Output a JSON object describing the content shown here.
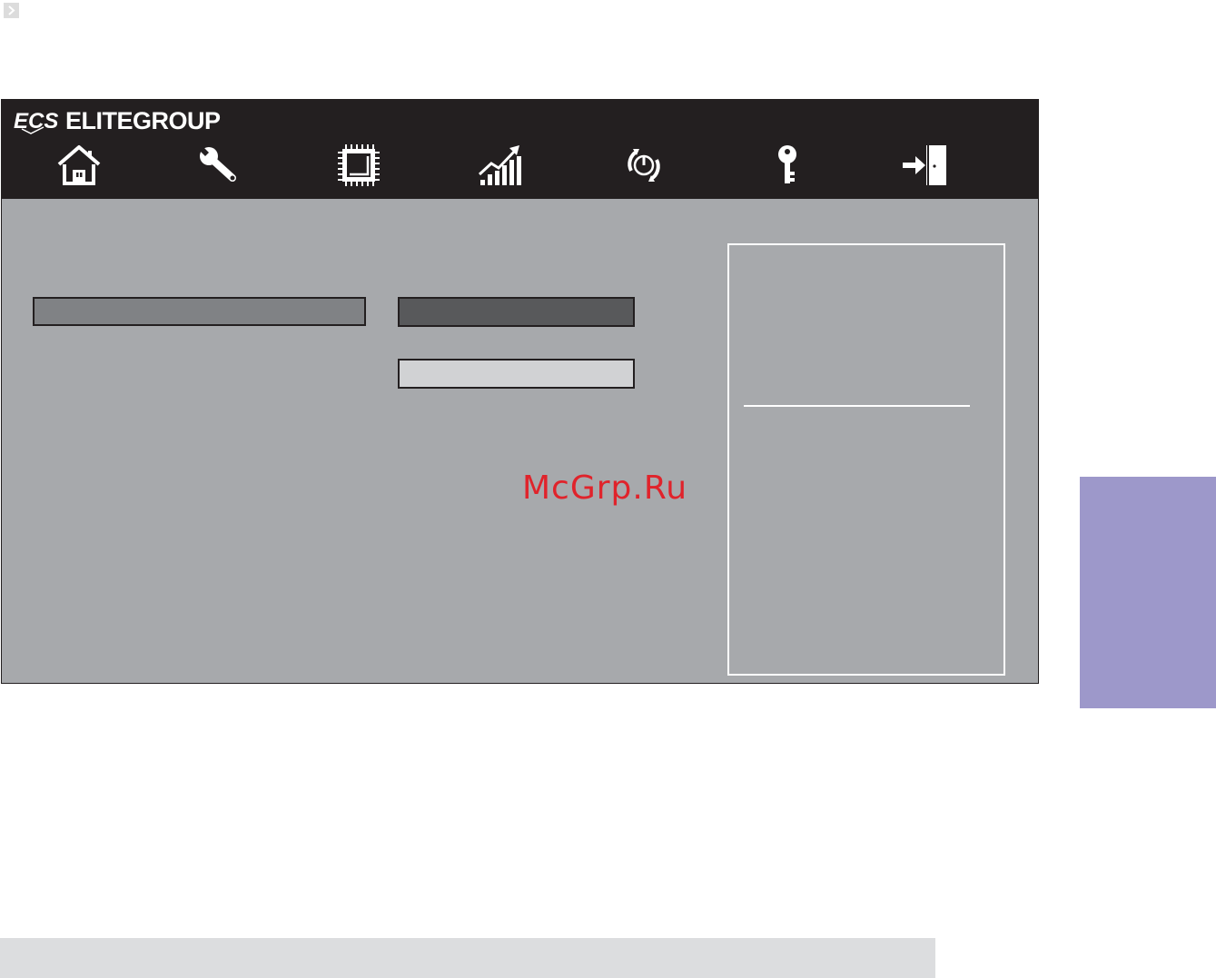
{
  "header": {
    "brand_logo_text": "ECS",
    "brand_name": "ELITEGROUP"
  },
  "nav": {
    "items": [
      {
        "icon": "home-icon"
      },
      {
        "icon": "wrench-icon"
      },
      {
        "icon": "chip-icon"
      },
      {
        "icon": "performance-chart-icon"
      },
      {
        "icon": "power-icon"
      },
      {
        "icon": "key-icon"
      },
      {
        "icon": "exit-door-icon"
      }
    ]
  },
  "fields": {
    "left": "",
    "selected": "",
    "option": ""
  },
  "help_panel": {
    "text": ""
  },
  "watermark": "McGrp.Ru",
  "colors": {
    "header_bg": "#231f20",
    "body_bg": "#a7a9ac",
    "side_tab": "#9d98ca",
    "watermark": "#e0232b"
  }
}
